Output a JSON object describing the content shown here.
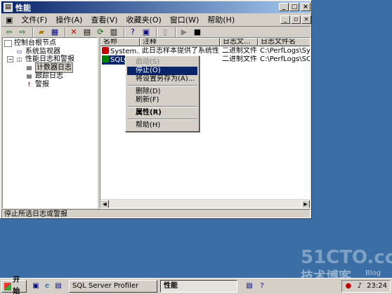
{
  "window": {
    "title": "性能"
  },
  "menu": [
    "文件(F)",
    "操作(A)",
    "查看(V)",
    "收藏夹(O)",
    "窗口(W)",
    "帮助(H)"
  ],
  "toolbar_icons": [
    "back-icon",
    "forward-icon",
    "up-folder-icon",
    "show-tree-icon",
    "delete-icon",
    "properties-icon",
    "refresh-icon",
    "export-icon",
    "help-icon",
    "console-icon",
    "new-icon",
    "start-icon",
    "stop-icon"
  ],
  "tree": {
    "root": "控制台根节点",
    "items": [
      "系统监视器",
      "性能日志和警报",
      "计数器日志",
      "跟踪日志",
      "警报"
    ]
  },
  "list": {
    "columns": [
      "名称",
      "注释",
      "日志文...",
      "日志文件名"
    ],
    "rows": [
      {
        "name": "System...",
        "comment": "此日志样本提供了系统性...",
        "type": "二进制文件",
        "file": "C:\\PerfLogs\\Sys..."
      },
      {
        "name": "SQLyo...",
        "comment": "",
        "type": "二进制文件",
        "file": "C:\\PerfLogs\\SQL..."
      }
    ]
  },
  "context_menu": {
    "start": "启动(S)",
    "stop": "停止(O)",
    "save_settings": "将设置另存为(A)...",
    "delete": "删除(D)",
    "refresh": "刷新(F)",
    "properties": "属性(R)",
    "help": "帮助(H)"
  },
  "status": "停止所选日志或警报",
  "taskbar": {
    "start": "开始",
    "tasks": [
      "SQL Server Profiler",
      "性能"
    ],
    "clock": "23:24"
  },
  "watermark": {
    "line1": "51CTO.com",
    "line2": "技术博客",
    "line3": "Blog"
  },
  "colors": {
    "desktop": "#3a6ea5",
    "titlebar": "#0a246a",
    "selection": "#0a246a",
    "face": "#d4d0c8"
  }
}
